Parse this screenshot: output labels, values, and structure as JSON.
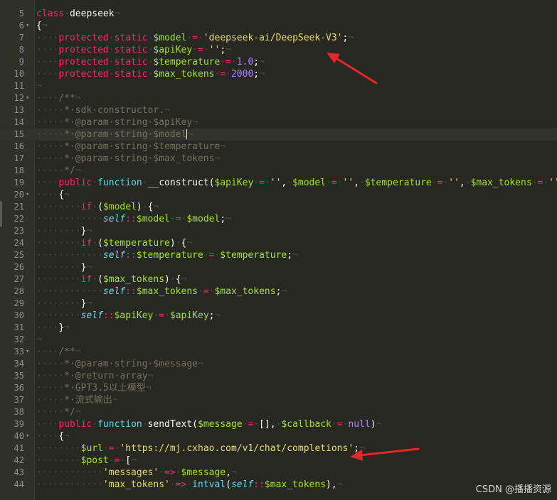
{
  "editor": {
    "line_numbers": [
      "5",
      "6",
      "7",
      "8",
      "9",
      "10",
      "11",
      "12",
      "13",
      "14",
      "15",
      "16",
      "17",
      "18",
      "19",
      "20",
      "21",
      "22",
      "23",
      "24",
      "25",
      "26",
      "27",
      "28",
      "29",
      "30",
      "31",
      "32",
      "33",
      "34",
      "35",
      "36",
      "37",
      "38",
      "39",
      "40",
      "41",
      "42",
      "43",
      "44"
    ],
    "lines": [
      [
        [
          "kw",
          "class"
        ],
        [
          "ws",
          "·"
        ],
        [
          "id",
          "deepseek"
        ],
        [
          "eol",
          "¬"
        ]
      ],
      [
        [
          "plain",
          "{"
        ],
        [
          "eol",
          "¬"
        ]
      ],
      [
        [
          "ws",
          "····"
        ],
        [
          "st",
          "protected"
        ],
        [
          "ws",
          "·"
        ],
        [
          "st",
          "static"
        ],
        [
          "ws",
          "·"
        ],
        [
          "var",
          "$model"
        ],
        [
          "ws",
          "·"
        ],
        [
          "st",
          "="
        ],
        [
          "ws",
          "·"
        ],
        [
          "str",
          "'deepseek-ai/DeepSeek-V3'"
        ],
        [
          "plain",
          ";"
        ],
        [
          "eol",
          "¬"
        ]
      ],
      [
        [
          "ws",
          "····"
        ],
        [
          "st",
          "protected"
        ],
        [
          "ws",
          "·"
        ],
        [
          "st",
          "static"
        ],
        [
          "ws",
          "·"
        ],
        [
          "var",
          "$apiKey"
        ],
        [
          "ws",
          "·"
        ],
        [
          "st",
          "="
        ],
        [
          "ws",
          "·"
        ],
        [
          "str",
          "''"
        ],
        [
          "plain",
          ";"
        ],
        [
          "eol",
          "¬"
        ]
      ],
      [
        [
          "ws",
          "····"
        ],
        [
          "st",
          "protected"
        ],
        [
          "ws",
          "·"
        ],
        [
          "st",
          "static"
        ],
        [
          "ws",
          "·"
        ],
        [
          "var",
          "$temperature"
        ],
        [
          "ws",
          "·"
        ],
        [
          "st",
          "="
        ],
        [
          "ws",
          "·"
        ],
        [
          "num",
          "1.0"
        ],
        [
          "plain",
          ";"
        ],
        [
          "eol",
          "¬"
        ]
      ],
      [
        [
          "ws",
          "····"
        ],
        [
          "st",
          "protected"
        ],
        [
          "ws",
          "·"
        ],
        [
          "st",
          "static"
        ],
        [
          "ws",
          "·"
        ],
        [
          "var",
          "$max_tokens"
        ],
        [
          "ws",
          "·"
        ],
        [
          "st",
          "="
        ],
        [
          "ws",
          "·"
        ],
        [
          "num",
          "2000"
        ],
        [
          "plain",
          ";"
        ],
        [
          "eol",
          "¬"
        ]
      ],
      [
        [
          "eol",
          "¬"
        ]
      ],
      [
        [
          "ws",
          "····"
        ],
        [
          "cm",
          "/**"
        ],
        [
          "eol",
          "¬"
        ]
      ],
      [
        [
          "ws",
          "·····"
        ],
        [
          "cm",
          "*·sdk·constructor."
        ],
        [
          "eol",
          "¬"
        ]
      ],
      [
        [
          "ws",
          "·····"
        ],
        [
          "cm",
          "*·@param·string·$apiKey"
        ],
        [
          "eol",
          "¬"
        ]
      ],
      [
        [
          "ws",
          "·····"
        ],
        [
          "cm",
          "*·@param·string·$model"
        ],
        [
          "cursor",
          ""
        ],
        [
          "eol",
          "¬"
        ]
      ],
      [
        [
          "ws",
          "·····"
        ],
        [
          "cm",
          "*·@param·string·$temperature"
        ],
        [
          "eol",
          "¬"
        ]
      ],
      [
        [
          "ws",
          "·····"
        ],
        [
          "cm",
          "*·@param·string·$max_tokens"
        ],
        [
          "eol",
          "¬"
        ]
      ],
      [
        [
          "ws",
          "·····"
        ],
        [
          "cm",
          "*/"
        ],
        [
          "eol",
          "¬"
        ]
      ],
      [
        [
          "ws",
          "····"
        ],
        [
          "kw",
          "public"
        ],
        [
          "ws",
          "·"
        ],
        [
          "fn",
          "function"
        ],
        [
          "ws",
          "·"
        ],
        [
          "id",
          "__construct("
        ],
        [
          "var",
          "$apiKey"
        ],
        [
          "ws",
          "·"
        ],
        [
          "st",
          "="
        ],
        [
          "ws",
          "·"
        ],
        [
          "str",
          "''"
        ],
        [
          "plain",
          ","
        ],
        [
          "ws",
          "·"
        ],
        [
          "var",
          "$model"
        ],
        [
          "ws",
          "·"
        ],
        [
          "st",
          "="
        ],
        [
          "ws",
          "·"
        ],
        [
          "str",
          "''"
        ],
        [
          "plain",
          ","
        ],
        [
          "ws",
          "·"
        ],
        [
          "var",
          "$temperature"
        ],
        [
          "ws",
          "·"
        ],
        [
          "st",
          "="
        ],
        [
          "ws",
          "·"
        ],
        [
          "str",
          "''"
        ],
        [
          "plain",
          ","
        ],
        [
          "ws",
          "·"
        ],
        [
          "var",
          "$max_tokens"
        ],
        [
          "ws",
          "·"
        ],
        [
          "st",
          "="
        ],
        [
          "ws",
          "·"
        ],
        [
          "str",
          "''"
        ],
        [
          "plain",
          ")"
        ]
      ],
      [
        [
          "ws",
          "····"
        ],
        [
          "plain",
          "{"
        ],
        [
          "eol",
          "¬"
        ]
      ],
      [
        [
          "ws",
          "········"
        ],
        [
          "kw",
          "if"
        ],
        [
          "ws",
          "·"
        ],
        [
          "plain",
          "("
        ],
        [
          "var",
          "$model"
        ],
        [
          "plain",
          ")"
        ],
        [
          "ws",
          "·"
        ],
        [
          "plain",
          "{"
        ],
        [
          "eol",
          "¬"
        ]
      ],
      [
        [
          "ws",
          "············"
        ],
        [
          "self",
          "self"
        ],
        [
          "st",
          "::"
        ],
        [
          "var",
          "$model"
        ],
        [
          "ws",
          "·"
        ],
        [
          "st",
          "="
        ],
        [
          "ws",
          "·"
        ],
        [
          "var",
          "$model"
        ],
        [
          "plain",
          ";"
        ],
        [
          "eol",
          "¬"
        ]
      ],
      [
        [
          "ws",
          "········"
        ],
        [
          "plain",
          "}"
        ],
        [
          "eol",
          "¬"
        ]
      ],
      [
        [
          "ws",
          "········"
        ],
        [
          "kw",
          "if"
        ],
        [
          "ws",
          "·"
        ],
        [
          "plain",
          "("
        ],
        [
          "var",
          "$temperature"
        ],
        [
          "plain",
          ")"
        ],
        [
          "ws",
          "·"
        ],
        [
          "plain",
          "{"
        ],
        [
          "eol",
          "¬"
        ]
      ],
      [
        [
          "ws",
          "············"
        ],
        [
          "self",
          "self"
        ],
        [
          "st",
          "::"
        ],
        [
          "var",
          "$temperature"
        ],
        [
          "ws",
          "·"
        ],
        [
          "st",
          "="
        ],
        [
          "ws",
          "·"
        ],
        [
          "var",
          "$temperature"
        ],
        [
          "plain",
          ";"
        ],
        [
          "eol",
          "¬"
        ]
      ],
      [
        [
          "ws",
          "········"
        ],
        [
          "plain",
          "}"
        ],
        [
          "eol",
          "¬"
        ]
      ],
      [
        [
          "ws",
          "········"
        ],
        [
          "kw",
          "if"
        ],
        [
          "ws",
          "·"
        ],
        [
          "plain",
          "("
        ],
        [
          "var",
          "$max_tokens"
        ],
        [
          "plain",
          ")"
        ],
        [
          "ws",
          "·"
        ],
        [
          "plain",
          "{"
        ],
        [
          "eol",
          "¬"
        ]
      ],
      [
        [
          "ws",
          "············"
        ],
        [
          "self",
          "self"
        ],
        [
          "st",
          "::"
        ],
        [
          "var",
          "$max_tokens"
        ],
        [
          "ws",
          "·"
        ],
        [
          "st",
          "="
        ],
        [
          "ws",
          "·"
        ],
        [
          "var",
          "$max_tokens"
        ],
        [
          "plain",
          ";"
        ],
        [
          "eol",
          "¬"
        ]
      ],
      [
        [
          "ws",
          "········"
        ],
        [
          "plain",
          "}"
        ],
        [
          "eol",
          "¬"
        ]
      ],
      [
        [
          "ws",
          "········"
        ],
        [
          "self",
          "self"
        ],
        [
          "st",
          "::"
        ],
        [
          "var",
          "$apiKey"
        ],
        [
          "ws",
          "·"
        ],
        [
          "st",
          "="
        ],
        [
          "ws",
          "·"
        ],
        [
          "var",
          "$apiKey"
        ],
        [
          "plain",
          ";"
        ],
        [
          "eol",
          "¬"
        ]
      ],
      [
        [
          "ws",
          "····"
        ],
        [
          "plain",
          "}"
        ],
        [
          "eol",
          "¬"
        ]
      ],
      [
        [
          "eol",
          "¬"
        ]
      ],
      [
        [
          "ws",
          "····"
        ],
        [
          "cm",
          "/**"
        ],
        [
          "eol",
          "¬"
        ]
      ],
      [
        [
          "ws",
          "·····"
        ],
        [
          "cm",
          "*·@param·string·$message"
        ],
        [
          "eol",
          "¬"
        ]
      ],
      [
        [
          "ws",
          "·····"
        ],
        [
          "cm",
          "*·@return·array"
        ],
        [
          "eol",
          "¬"
        ]
      ],
      [
        [
          "ws",
          "·····"
        ],
        [
          "cm",
          "*·GPT3.5以上模型"
        ],
        [
          "eol",
          "¬"
        ]
      ],
      [
        [
          "ws",
          "·····"
        ],
        [
          "cm",
          "*·流式输出"
        ],
        [
          "eol",
          "¬"
        ]
      ],
      [
        [
          "ws",
          "·····"
        ],
        [
          "cm",
          "*/"
        ],
        [
          "eol",
          "¬"
        ]
      ],
      [
        [
          "ws",
          "····"
        ],
        [
          "kw",
          "public"
        ],
        [
          "ws",
          "·"
        ],
        [
          "fn",
          "function"
        ],
        [
          "ws",
          "·"
        ],
        [
          "id",
          "sendText("
        ],
        [
          "var",
          "$message"
        ],
        [
          "ws",
          "·"
        ],
        [
          "st",
          "="
        ],
        [
          "ws",
          "·"
        ],
        [
          "plain",
          "[],"
        ],
        [
          "ws",
          "·"
        ],
        [
          "var",
          "$callback"
        ],
        [
          "ws",
          "·"
        ],
        [
          "st",
          "="
        ],
        [
          "ws",
          "·"
        ],
        [
          "num",
          "null"
        ],
        [
          "plain",
          ")"
        ],
        [
          "eol",
          "¬"
        ]
      ],
      [
        [
          "ws",
          "····"
        ],
        [
          "plain",
          "{"
        ],
        [
          "eol",
          "¬"
        ]
      ],
      [
        [
          "ws",
          "········"
        ],
        [
          "var",
          "$url"
        ],
        [
          "ws",
          "·"
        ],
        [
          "st",
          "="
        ],
        [
          "ws",
          "·"
        ],
        [
          "str",
          "'https://mj.cxhao.com/v1/chat/completions'"
        ],
        [
          "plain",
          ";"
        ],
        [
          "eol",
          "¬"
        ]
      ],
      [
        [
          "ws",
          "········"
        ],
        [
          "var",
          "$post"
        ],
        [
          "ws",
          "·"
        ],
        [
          "st",
          "="
        ],
        [
          "ws",
          "·"
        ],
        [
          "plain",
          "["
        ],
        [
          "eol",
          "¬"
        ]
      ],
      [
        [
          "ws",
          "············"
        ],
        [
          "str",
          "'messages'"
        ],
        [
          "ws",
          "·"
        ],
        [
          "st",
          "=>"
        ],
        [
          "ws",
          "·"
        ],
        [
          "var",
          "$message"
        ],
        [
          "plain",
          ","
        ],
        [
          "eol",
          "¬"
        ]
      ],
      [
        [
          "ws",
          "············"
        ],
        [
          "str",
          "'max_tokens'"
        ],
        [
          "ws",
          "·"
        ],
        [
          "st",
          "=>"
        ],
        [
          "ws",
          "·"
        ],
        [
          "fn",
          "intval"
        ],
        [
          "plain",
          "("
        ],
        [
          "self",
          "self"
        ],
        [
          "st",
          "::"
        ],
        [
          "var",
          "$max_tokens"
        ],
        [
          "plain",
          "),"
        ],
        [
          "eol",
          "¬"
        ]
      ]
    ],
    "active_line": "15",
    "fold_lines": [
      "6",
      "12",
      "20",
      "33",
      "40"
    ],
    "fold_glyph": "▾",
    "colors": {
      "background": "#272822",
      "gutter": "#2f3129",
      "keyword": "#f92672",
      "function": "#66d9ef",
      "variable": "#a6e22e",
      "string": "#e6db74",
      "number": "#ae81ff",
      "comment": "#75715e",
      "annotation_arrow": "#e8262a"
    },
    "annotations": [
      "red-arrow",
      "red-arrow"
    ]
  },
  "watermark": "CSDN @播播资源"
}
